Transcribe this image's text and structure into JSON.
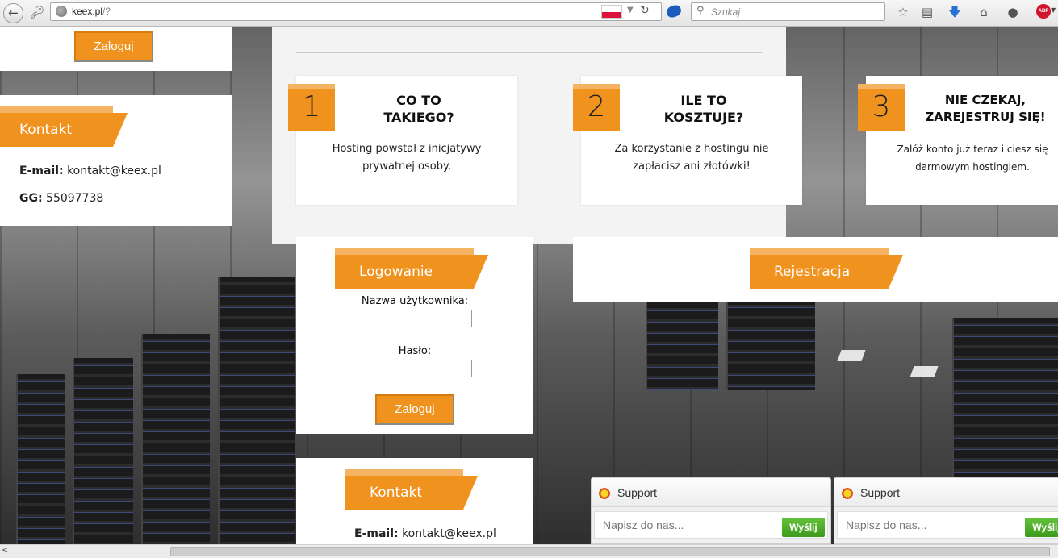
{
  "browser": {
    "url_host": "keex.pl",
    "url_path": "/?",
    "search_placeholder": "Szukaj"
  },
  "sidebar": {
    "login_button": "Zaloguj",
    "contact_title": "Kontakt",
    "email_label": "E-mail:",
    "email_value": "kontakt@keex.pl",
    "gg_label": "GG:",
    "gg_value": "55097738"
  },
  "steps": [
    {
      "number": "1",
      "title_line1": "CO TO",
      "title_line2": "TAKIEGO?",
      "desc_line1": "Hosting powstał z inicjatywy",
      "desc_line2": "prywatnej osoby."
    },
    {
      "number": "2",
      "title_line1": "ILE TO",
      "title_line2": "KOSZTUJE?",
      "desc_line1": "Za korzystanie z hostingu nie",
      "desc_line2": "zapłacisz ani złotówki!"
    },
    {
      "number": "3",
      "title_line1": "NIE CZEKAJ,",
      "title_line2": "ZAREJESTRUJ SIĘ!",
      "desc_line1": "Załóż konto już teraz i ciesz się",
      "desc_line2": "darmowym hostingiem."
    }
  ],
  "login_form": {
    "title": "Logowanie",
    "username_label": "Nazwa użytkownika:",
    "password_label": "Hasło:",
    "submit": "Zaloguj"
  },
  "register": {
    "title": "Rejestracja"
  },
  "contact2": {
    "title": "Kontakt",
    "email_label": "E-mail:",
    "email_value": "kontakt@keex.pl"
  },
  "chat": [
    {
      "title": "Support",
      "placeholder": "Napisz do nas...",
      "send": "Wyślij"
    },
    {
      "title": "Support",
      "placeholder": "Napisz do nas...",
      "send": "Wyślij"
    }
  ],
  "colors": {
    "accent": "#f0921e",
    "accent_light": "#f5b463",
    "send_green": "#4aa824"
  }
}
